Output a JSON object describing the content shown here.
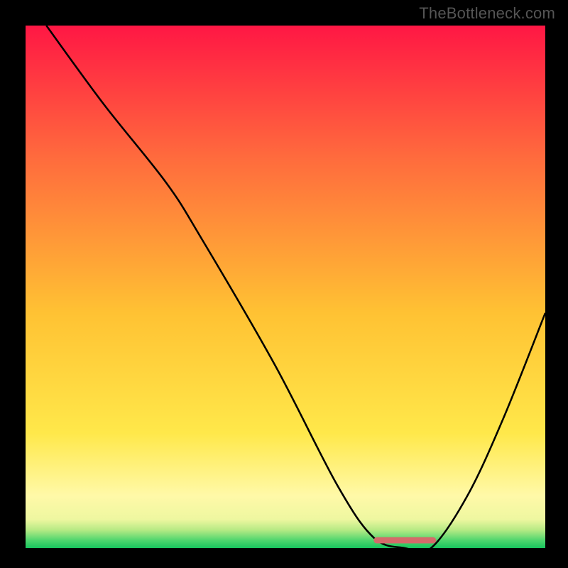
{
  "watermark": "TheBottleneck.com",
  "chart_data": {
    "type": "line",
    "title": "",
    "xlabel": "",
    "ylabel": "",
    "xlim": [
      0,
      100
    ],
    "ylim": [
      0,
      100
    ],
    "grid": false,
    "legend": false,
    "background_gradient": {
      "stops": [
        {
          "pos": 0.0,
          "color": "#ff1744"
        },
        {
          "pos": 0.25,
          "color": "#ff6a3d"
        },
        {
          "pos": 0.55,
          "color": "#ffc233"
        },
        {
          "pos": 0.78,
          "color": "#ffe84a"
        },
        {
          "pos": 0.9,
          "color": "#fff9a8"
        },
        {
          "pos": 0.945,
          "color": "#eef7a0"
        },
        {
          "pos": 0.965,
          "color": "#b7ea85"
        },
        {
          "pos": 0.985,
          "color": "#4fd66e"
        },
        {
          "pos": 1.0,
          "color": "#18c45e"
        }
      ]
    },
    "series": [
      {
        "name": "bottleneck-curve",
        "color": "#000000",
        "x": [
          4,
          15,
          27,
          34,
          48,
          60,
          67,
          73,
          78,
          85,
          92,
          100
        ],
        "y": [
          100,
          85,
          70,
          59,
          35,
          12,
          2,
          0,
          0,
          10,
          25,
          45
        ]
      }
    ],
    "optimum_marker": {
      "x_start": 67,
      "x_end": 79,
      "y": 1.5,
      "color": "#d46a6a"
    }
  }
}
